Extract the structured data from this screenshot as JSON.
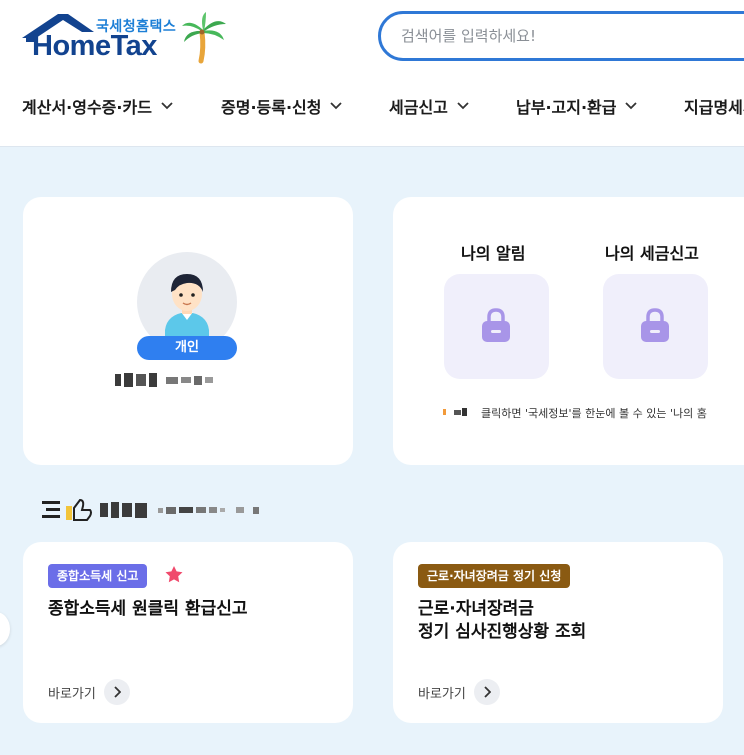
{
  "logo": {
    "kr": "국세청홈택스",
    "en": "HomeTax"
  },
  "search": {
    "placeholder": "검색어를 입력하세요!"
  },
  "nav": [
    {
      "label": "계산서·영수증·카드"
    },
    {
      "label": "증명·등록·신청"
    },
    {
      "label": "세금신고"
    },
    {
      "label": "납부·고지·환급"
    },
    {
      "label": "지급명세서"
    }
  ],
  "profile": {
    "badge": "개인"
  },
  "info": {
    "alert_title": "나의 알림",
    "tax_title": "나의 세금신고",
    "note": "클릭하면 '국세정보'를 한눈에 볼 수 있는 '나의 홈"
  },
  "services": [
    {
      "tag": "종합소득세 신고",
      "tag_color": "#6b6ee8",
      "title_lines": [
        "종합소득세 원클릭 환급신고"
      ],
      "link": "바로가기"
    },
    {
      "tag": "근로·자녀장려금 정기 신청",
      "tag_color": "#8a5a12",
      "title_lines": [
        "근로·자녀장려금",
        "정기 심사진행상황 조회"
      ],
      "link": "바로가기"
    }
  ],
  "colors": {
    "accent": "#2f78d6",
    "background": "#e8f3fb",
    "star": "#f04a6c"
  }
}
